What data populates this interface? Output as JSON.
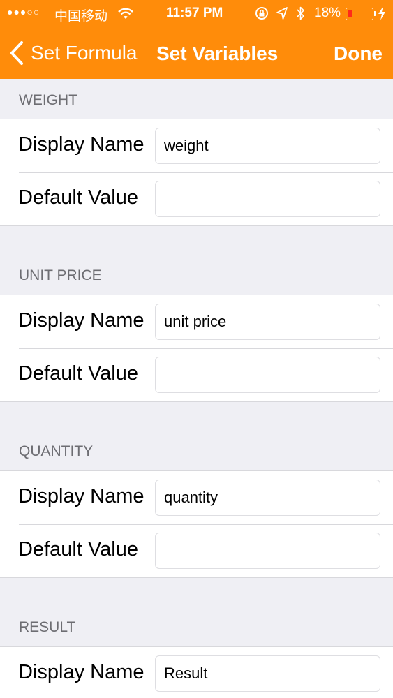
{
  "status_bar": {
    "signal_dots": "●●●○○",
    "carrier": "中国移动",
    "time": "11:57 PM",
    "battery_percent": "18%",
    "battery_level": 0.18,
    "battery_color": "#ff2a1a"
  },
  "nav": {
    "back_label": "Set Formula",
    "title": "Set Variables",
    "done_label": "Done",
    "bar_color": "#ff8c0a"
  },
  "sections": [
    {
      "header": "WEIGHT",
      "display_name_label": "Display Name",
      "display_name_value": "weight",
      "default_value_label": "Default Value",
      "default_value_value": ""
    },
    {
      "header": "UNIT PRICE",
      "display_name_label": "Display Name",
      "display_name_value": "unit price",
      "default_value_label": "Default Value",
      "default_value_value": ""
    },
    {
      "header": "QUANTITY",
      "display_name_label": "Display Name",
      "display_name_value": "quantity",
      "default_value_label": "Default Value",
      "default_value_value": ""
    },
    {
      "header": "RESULT",
      "display_name_label": "Display Name",
      "display_name_value": "Result"
    }
  ]
}
